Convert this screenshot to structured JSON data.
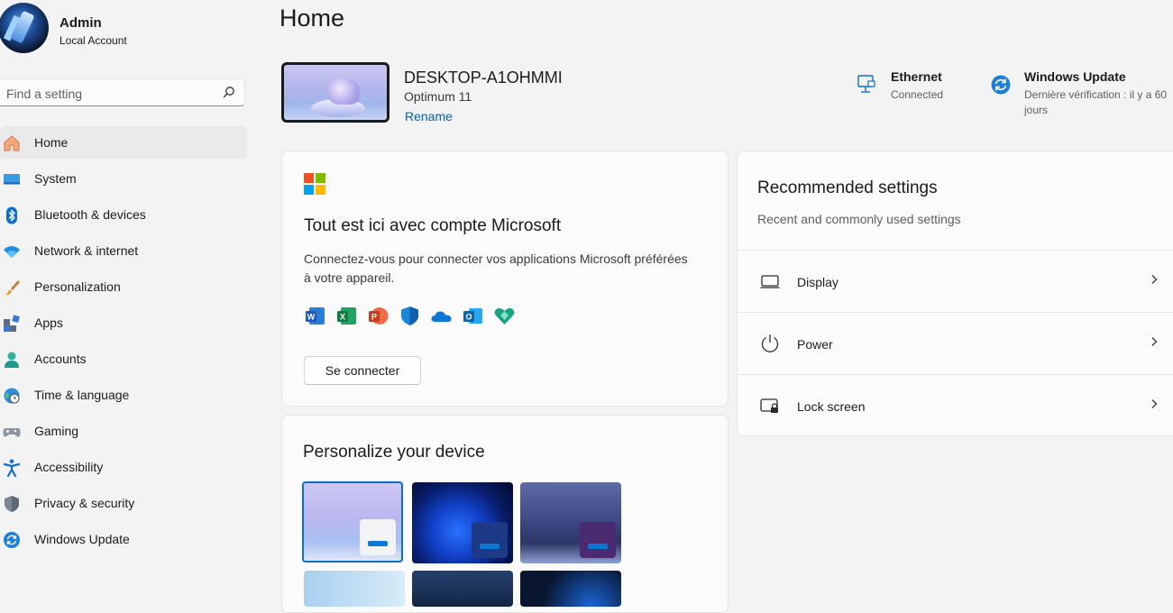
{
  "user": {
    "name": "Admin",
    "account_type": "Local Account"
  },
  "search": {
    "placeholder": "Find a setting",
    "value": ""
  },
  "nav": {
    "items": [
      {
        "label": "Home",
        "icon": "home-icon",
        "active": true
      },
      {
        "label": "System",
        "icon": "system-icon"
      },
      {
        "label": "Bluetooth & devices",
        "icon": "bluetooth-icon"
      },
      {
        "label": "Network & internet",
        "icon": "network-icon"
      },
      {
        "label": "Personalization",
        "icon": "brush-icon"
      },
      {
        "label": "Apps",
        "icon": "apps-icon"
      },
      {
        "label": "Accounts",
        "icon": "accounts-icon"
      },
      {
        "label": "Time & language",
        "icon": "time-language-icon"
      },
      {
        "label": "Gaming",
        "icon": "gaming-icon"
      },
      {
        "label": "Accessibility",
        "icon": "accessibility-icon"
      },
      {
        "label": "Privacy & security",
        "icon": "shield-icon"
      },
      {
        "label": "Windows Update",
        "icon": "windows-update-icon"
      }
    ]
  },
  "page": {
    "title": "Home"
  },
  "device": {
    "name": "DESKTOP-A1OHMMI",
    "model": "Optimum 11",
    "rename_label": "Rename"
  },
  "status": {
    "ethernet": {
      "title": "Ethernet",
      "detail": "Connected"
    },
    "update": {
      "title": "Windows Update",
      "detail_line1": "Dernière vérification : il y a 60",
      "detail_line2": "jours"
    }
  },
  "microsoft_card": {
    "title": "Tout est ici avec compte Microsoft",
    "body_line1": "Connectez-vous pour connecter vos applications Microsoft préférées",
    "body_line2": "à votre appareil.",
    "apps": [
      "word-icon",
      "excel-icon",
      "powerpoint-icon",
      "defender-icon",
      "onedrive-icon",
      "outlook-icon",
      "family-icon"
    ],
    "button_label": "Se connecter"
  },
  "recommended": {
    "title": "Recommended settings",
    "subtitle": "Recent and commonly used settings",
    "items": [
      {
        "label": "Display",
        "icon": "display-icon"
      },
      {
        "label": "Power",
        "icon": "power-icon"
      },
      {
        "label": "Lock screen",
        "icon": "lock-screen-icon"
      }
    ]
  },
  "personalize": {
    "title": "Personalize your device"
  },
  "colors": {
    "accent": "#005fb8",
    "background": "#f3f3f3",
    "card": "#fbfbfb"
  }
}
